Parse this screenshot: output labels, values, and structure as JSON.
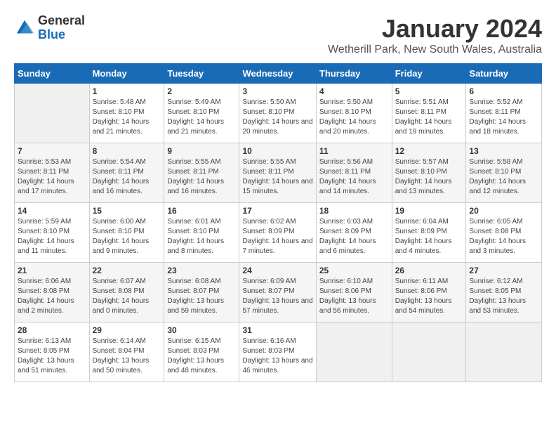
{
  "header": {
    "logo_general": "General",
    "logo_blue": "Blue",
    "title": "January 2024",
    "subtitle": "Wetherill Park, New South Wales, Australia"
  },
  "weekdays": [
    "Sunday",
    "Monday",
    "Tuesday",
    "Wednesday",
    "Thursday",
    "Friday",
    "Saturday"
  ],
  "weeks": [
    [
      {
        "day": "",
        "empty": true
      },
      {
        "day": "1",
        "sunrise": "5:48 AM",
        "sunset": "8:10 PM",
        "daylight": "14 hours and 21 minutes."
      },
      {
        "day": "2",
        "sunrise": "5:49 AM",
        "sunset": "8:10 PM",
        "daylight": "14 hours and 21 minutes."
      },
      {
        "day": "3",
        "sunrise": "5:50 AM",
        "sunset": "8:10 PM",
        "daylight": "14 hours and 20 minutes."
      },
      {
        "day": "4",
        "sunrise": "5:50 AM",
        "sunset": "8:10 PM",
        "daylight": "14 hours and 20 minutes."
      },
      {
        "day": "5",
        "sunrise": "5:51 AM",
        "sunset": "8:11 PM",
        "daylight": "14 hours and 19 minutes."
      },
      {
        "day": "6",
        "sunrise": "5:52 AM",
        "sunset": "8:11 PM",
        "daylight": "14 hours and 18 minutes."
      }
    ],
    [
      {
        "day": "7",
        "sunrise": "5:53 AM",
        "sunset": "8:11 PM",
        "daylight": "14 hours and 17 minutes."
      },
      {
        "day": "8",
        "sunrise": "5:54 AM",
        "sunset": "8:11 PM",
        "daylight": "14 hours and 16 minutes."
      },
      {
        "day": "9",
        "sunrise": "5:55 AM",
        "sunset": "8:11 PM",
        "daylight": "14 hours and 16 minutes."
      },
      {
        "day": "10",
        "sunrise": "5:55 AM",
        "sunset": "8:11 PM",
        "daylight": "14 hours and 15 minutes."
      },
      {
        "day": "11",
        "sunrise": "5:56 AM",
        "sunset": "8:11 PM",
        "daylight": "14 hours and 14 minutes."
      },
      {
        "day": "12",
        "sunrise": "5:57 AM",
        "sunset": "8:10 PM",
        "daylight": "14 hours and 13 minutes."
      },
      {
        "day": "13",
        "sunrise": "5:58 AM",
        "sunset": "8:10 PM",
        "daylight": "14 hours and 12 minutes."
      }
    ],
    [
      {
        "day": "14",
        "sunrise": "5:59 AM",
        "sunset": "8:10 PM",
        "daylight": "14 hours and 11 minutes."
      },
      {
        "day": "15",
        "sunrise": "6:00 AM",
        "sunset": "8:10 PM",
        "daylight": "14 hours and 9 minutes."
      },
      {
        "day": "16",
        "sunrise": "6:01 AM",
        "sunset": "8:10 PM",
        "daylight": "14 hours and 8 minutes."
      },
      {
        "day": "17",
        "sunrise": "6:02 AM",
        "sunset": "8:09 PM",
        "daylight": "14 hours and 7 minutes."
      },
      {
        "day": "18",
        "sunrise": "6:03 AM",
        "sunset": "8:09 PM",
        "daylight": "14 hours and 6 minutes."
      },
      {
        "day": "19",
        "sunrise": "6:04 AM",
        "sunset": "8:09 PM",
        "daylight": "14 hours and 4 minutes."
      },
      {
        "day": "20",
        "sunrise": "6:05 AM",
        "sunset": "8:08 PM",
        "daylight": "14 hours and 3 minutes."
      }
    ],
    [
      {
        "day": "21",
        "sunrise": "6:06 AM",
        "sunset": "8:08 PM",
        "daylight": "14 hours and 2 minutes."
      },
      {
        "day": "22",
        "sunrise": "6:07 AM",
        "sunset": "8:08 PM",
        "daylight": "14 hours and 0 minutes."
      },
      {
        "day": "23",
        "sunrise": "6:08 AM",
        "sunset": "8:07 PM",
        "daylight": "13 hours and 59 minutes."
      },
      {
        "day": "24",
        "sunrise": "6:09 AM",
        "sunset": "8:07 PM",
        "daylight": "13 hours and 57 minutes."
      },
      {
        "day": "25",
        "sunrise": "6:10 AM",
        "sunset": "8:06 PM",
        "daylight": "13 hours and 56 minutes."
      },
      {
        "day": "26",
        "sunrise": "6:11 AM",
        "sunset": "8:06 PM",
        "daylight": "13 hours and 54 minutes."
      },
      {
        "day": "27",
        "sunrise": "6:12 AM",
        "sunset": "8:05 PM",
        "daylight": "13 hours and 53 minutes."
      }
    ],
    [
      {
        "day": "28",
        "sunrise": "6:13 AM",
        "sunset": "8:05 PM",
        "daylight": "13 hours and 51 minutes."
      },
      {
        "day": "29",
        "sunrise": "6:14 AM",
        "sunset": "8:04 PM",
        "daylight": "13 hours and 50 minutes."
      },
      {
        "day": "30",
        "sunrise": "6:15 AM",
        "sunset": "8:03 PM",
        "daylight": "13 hours and 48 minutes."
      },
      {
        "day": "31",
        "sunrise": "6:16 AM",
        "sunset": "8:03 PM",
        "daylight": "13 hours and 46 minutes."
      },
      {
        "day": "",
        "empty": true
      },
      {
        "day": "",
        "empty": true
      },
      {
        "day": "",
        "empty": true
      }
    ]
  ],
  "labels": {
    "sunrise": "Sunrise:",
    "sunset": "Sunset:",
    "daylight": "Daylight:"
  }
}
